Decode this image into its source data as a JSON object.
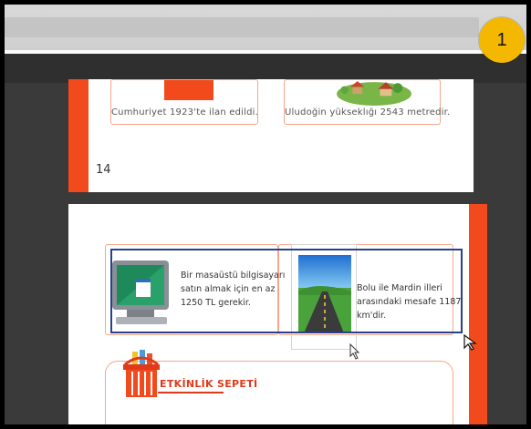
{
  "badge": {
    "number": "1"
  },
  "page_top": {
    "cards": [
      {
        "caption": "Cumhuriyet 1923'te ilan edildi."
      },
      {
        "caption": "Uludoğin yükseklığı 2543 metredir."
      }
    ],
    "page_number": "14"
  },
  "page_bottom": {
    "items": [
      {
        "text_lines": [
          "Bir masaüstü bilgisayarı",
          "satın almak için en az",
          "1250 TL gerekir."
        ],
        "icon": "desktop-computer-icon"
      },
      {
        "text_lines": [
          "Bolu ile Mardin illeri",
          "arasındaki mesafe 1187",
          "km'dir."
        ],
        "icon": "road-landscape-icon"
      }
    ],
    "activity_label": "ETKİNLİK SEPETİ",
    "activity_icon": "basket-icon"
  },
  "colors": {
    "accent_orange": "#f24a1c",
    "card_border": "#f6a58c",
    "selection_blue": "#27418a",
    "badge_yellow": "#f5b800"
  }
}
